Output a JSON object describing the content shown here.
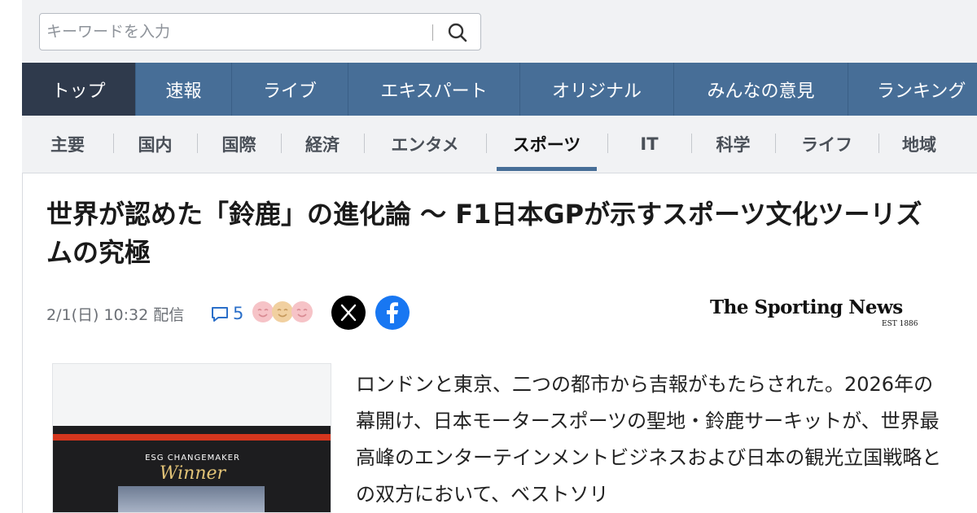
{
  "search": {
    "placeholder": "キーワードを入力"
  },
  "main_nav": {
    "tabs": [
      {
        "label": "トップ",
        "active": true
      },
      {
        "label": "速報"
      },
      {
        "label": "ライブ"
      },
      {
        "label": "エキスパート"
      },
      {
        "label": "オリジナル"
      },
      {
        "label": "みんなの意見"
      },
      {
        "label": "ランキング"
      }
    ]
  },
  "sub_nav": {
    "items": [
      {
        "label": "主要"
      },
      {
        "label": "国内"
      },
      {
        "label": "国際"
      },
      {
        "label": "経済"
      },
      {
        "label": "エンタメ"
      },
      {
        "label": "スポーツ",
        "active": true
      },
      {
        "label": "IT"
      },
      {
        "label": "科学"
      },
      {
        "label": "ライフ"
      },
      {
        "label": "地域"
      }
    ]
  },
  "article": {
    "headline": "世界が認めた「鈴鹿」の進化論 〜 F1日本GPが示すスポーツ文化ツーリズムの究極",
    "date": "2/1(日) 10:32 配信",
    "comment_count": "5",
    "publisher": {
      "name": "The Sporting News",
      "est": "EST 1886"
    },
    "thumbnail": {
      "subtitle": "ESG CHANGEMAKER",
      "winner": "Winner"
    },
    "body": "ロンドンと東京、二つの都市から吉報がもたらされた。2026年の幕開け、日本モータースポーツの聖地・鈴鹿サーキットが、世界最高峰のエンターテインメントビジネスおよび日本の観光立国戦略との双方において、ベストソリ"
  },
  "colors": {
    "nav_blue": "#476e97",
    "nav_active": "#2f3a4c",
    "comment_blue": "#2b6fc9",
    "facebook_blue": "#1877f2"
  },
  "icons": [
    "search-icon",
    "comment-icon",
    "reaction-icon",
    "x-logo-icon",
    "facebook-icon"
  ]
}
